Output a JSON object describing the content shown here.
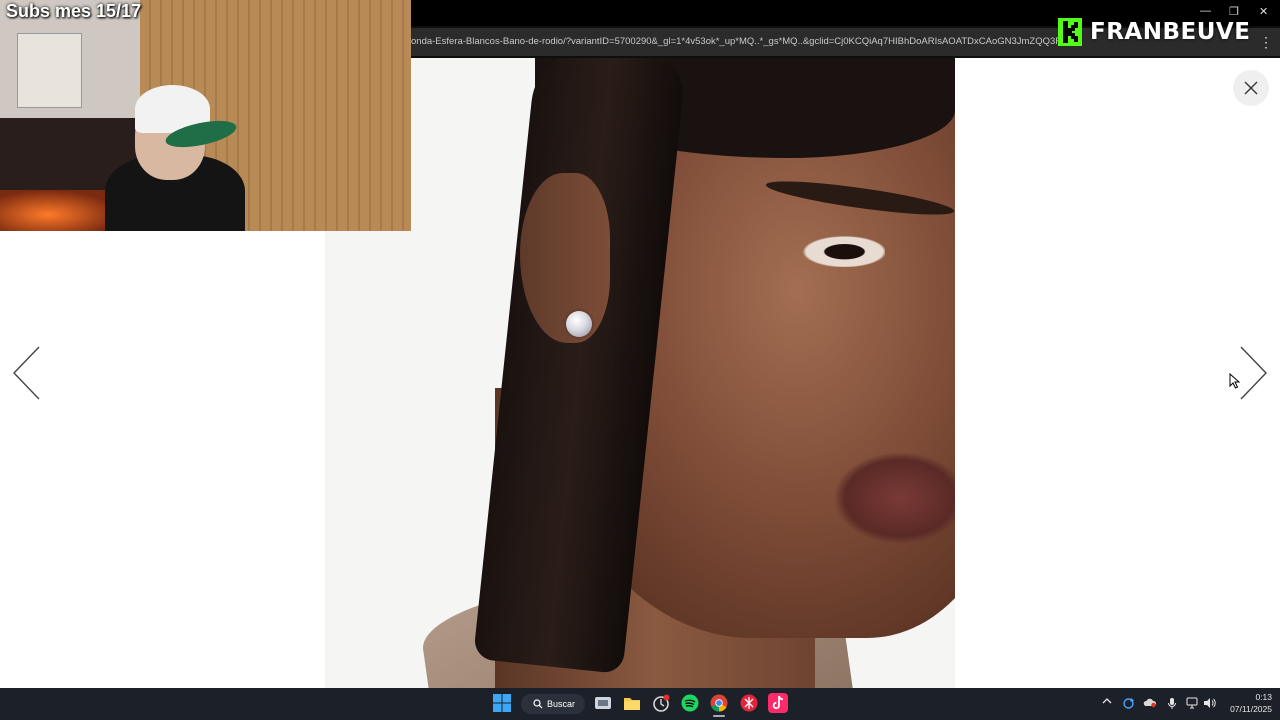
{
  "browser": {
    "url": "onda-Esfera-Blancos-Bano-de-rodio/?variantID=5700290&_gl=1*4v53ok*_up*MQ..*_gs*MQ..&gclid=Cj0KCQiAq7HIBhDoARIsAOATDxCAoGN3JmZQQ3Fk-j9...",
    "menu_glyph": "⋮",
    "minimize_glyph": "—",
    "restore_glyph": "❐",
    "close_glyph": "✕"
  },
  "overlay": {
    "subs_text": "Subs mes 15/17",
    "brand_name": "FRANBEUVE",
    "brand_color": "#53fc18"
  },
  "lightbox": {
    "close_glyph": "×",
    "prev_icon": "chevron-left-icon",
    "next_icon": "chevron-right-icon"
  },
  "taskbar": {
    "search_label": "Buscar",
    "apps": [
      "windows-start",
      "task-view",
      "file-explorer",
      "app-with-notification",
      "spotify",
      "chrome",
      "app-red",
      "tiktok"
    ],
    "time": "0:13",
    "date": "07/11/2025"
  }
}
